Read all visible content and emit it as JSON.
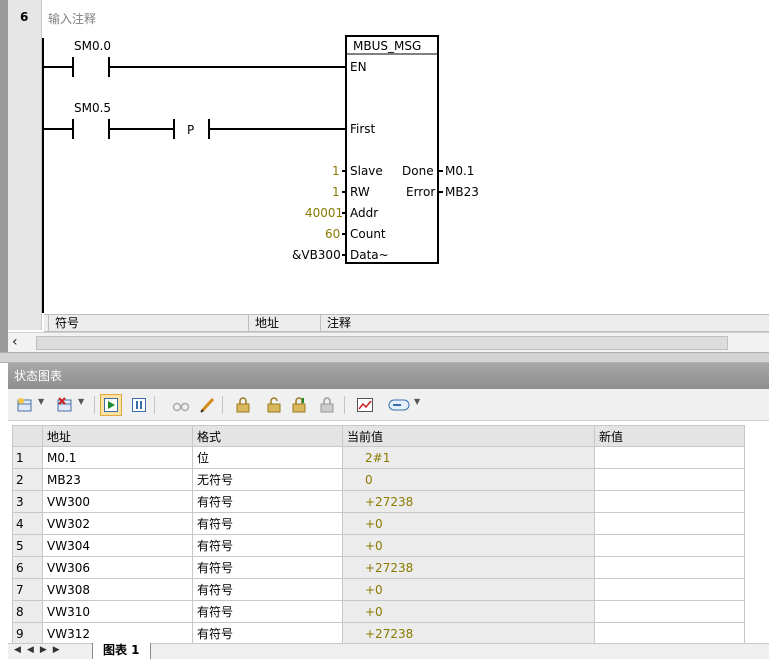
{
  "network": {
    "number": "6",
    "comment": "输入注释",
    "contact1": "SM0.0",
    "contact2": "SM0.5",
    "p_label": "P",
    "block": {
      "title": "MBUS_MSG",
      "pins_in": [
        "EN",
        "First",
        "Slave",
        "RW",
        "Addr",
        "Count",
        "Data~"
      ],
      "pins_out": [
        "Done",
        "Error"
      ],
      "in_values": {
        "slave": "1",
        "rw": "1",
        "addr": "40001",
        "count": "60",
        "data": "&VB300"
      },
      "out_values": {
        "done": "M0.1",
        "error": "MB23"
      }
    }
  },
  "symbol_table_header": {
    "symbol": "符号",
    "address": "地址",
    "comment": "注释"
  },
  "status_chart": {
    "title": "状态图表",
    "columns": {
      "address": "地址",
      "format": "格式",
      "current": "当前值",
      "new": "新值"
    },
    "rows": [
      {
        "n": "1",
        "addr": "M0.1",
        "fmt": "位",
        "cur": "2#1",
        "new": ""
      },
      {
        "n": "2",
        "addr": "MB23",
        "fmt": "无符号",
        "cur": "0",
        "new": ""
      },
      {
        "n": "3",
        "addr": "VW300",
        "fmt": "有符号",
        "cur": "+27238",
        "new": ""
      },
      {
        "n": "4",
        "addr": "VW302",
        "fmt": "有符号",
        "cur": "+0",
        "new": ""
      },
      {
        "n": "5",
        "addr": "VW304",
        "fmt": "有符号",
        "cur": "+0",
        "new": ""
      },
      {
        "n": "6",
        "addr": "VW306",
        "fmt": "有符号",
        "cur": "+27238",
        "new": ""
      },
      {
        "n": "7",
        "addr": "VW308",
        "fmt": "有符号",
        "cur": "+0",
        "new": ""
      },
      {
        "n": "8",
        "addr": "VW310",
        "fmt": "有符号",
        "cur": "+0",
        "new": ""
      },
      {
        "n": "9",
        "addr": "VW312",
        "fmt": "有符号",
        "cur": "+27238",
        "new": ""
      }
    ],
    "sheet_tab": "图表 1"
  },
  "colors": {
    "value_text": "#8a7a00",
    "panel_title": "#999999"
  }
}
